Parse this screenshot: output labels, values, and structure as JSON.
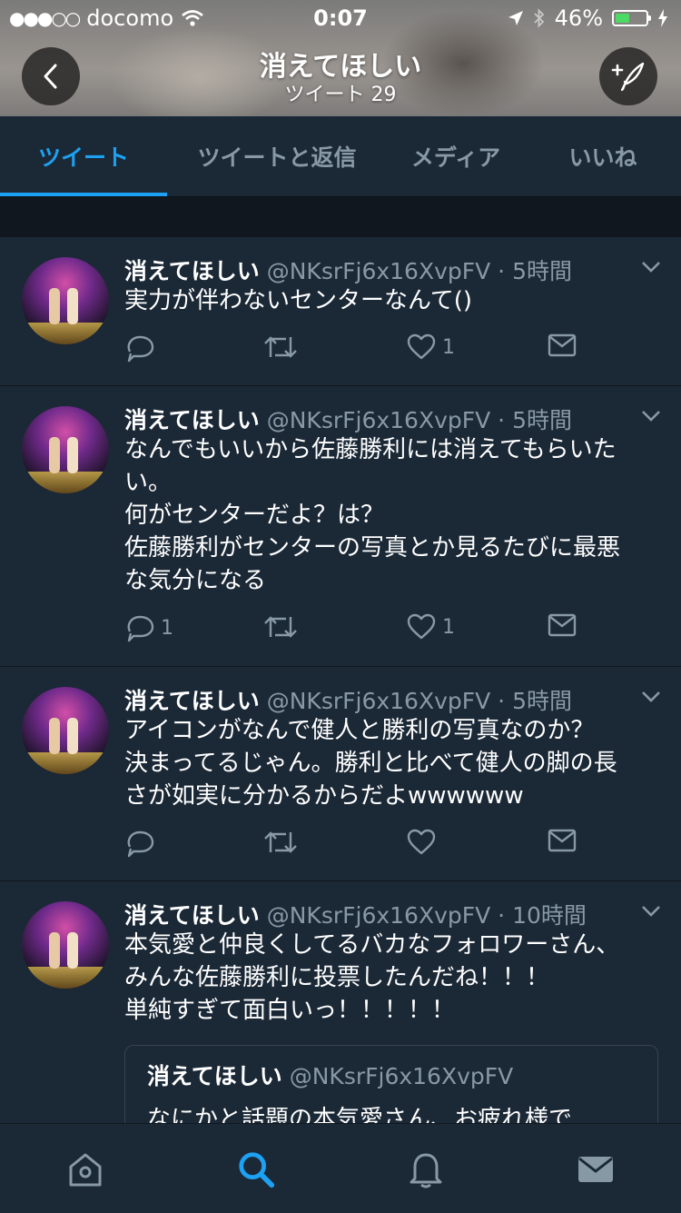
{
  "status_bar": {
    "signal_dots": "●●●○○",
    "carrier": "docomo",
    "time": "0:07",
    "battery_percent": "46%",
    "battery_level": 0.46
  },
  "header": {
    "title": "消えてほしい",
    "tweet_count": "ツイート 29"
  },
  "tabs": [
    {
      "label": "ツイート",
      "active": true
    },
    {
      "label": "ツイートと返信",
      "active": false
    },
    {
      "label": "メディア",
      "active": false
    },
    {
      "label": "いいね",
      "active": false
    }
  ],
  "tweets": [
    {
      "name": "消えてほしい",
      "meta": "@NKsrFj6x16XvpFV · 5時間",
      "lines": [
        "実力が伴わないセンターなんて()"
      ],
      "reply_count": "",
      "like_count": "1"
    },
    {
      "name": "消えてほしい",
      "meta": "@NKsrFj6x16XvpFV · 5時間",
      "lines": [
        "なんでもいいから佐藤勝利には消えてもらいた",
        "い。",
        "何がセンターだよ？は？",
        "佐藤勝利がセンターの写真とか見るたびに最悪",
        "な気分になる"
      ],
      "reply_count": "1",
      "like_count": "1"
    },
    {
      "name": "消えてほしい",
      "meta": "@NKsrFj6x16XvpFV · 5時間",
      "lines": [
        "アイコンがなんで健人と勝利の写真なのか？",
        "決まってるじゃん。勝利と比べて健人の脚の長",
        "さが如実に分かるからだよwwwwww"
      ],
      "reply_count": "",
      "like_count": ""
    },
    {
      "name": "消えてほしい",
      "meta": "@NKsrFj6x16XvpFV · 10時間",
      "lines": [
        "本気愛と仲良くしてるバカなフォロワーさん、",
        "みんな佐藤勝利に投票したんだね！！！",
        "単純すぎて面白いっ！！！！！"
      ],
      "quote": {
        "name": "消えてほしい",
        "handle": "@NKsrFj6x16XvpFV",
        "text": "なにかと話題の本気愛さん、お疲れ様で"
      }
    }
  ],
  "icons": {
    "back": "chevron-left-icon",
    "compose": "compose-tweet-icon",
    "reply": "reply-icon",
    "retweet": "retweet-icon",
    "like": "heart-icon",
    "dm": "envelope-icon",
    "more": "chevron-down-icon",
    "nav_home": "home-icon",
    "nav_search": "search-icon",
    "nav_notifications": "bell-icon",
    "nav_messages": "envelope-icon"
  },
  "colors": {
    "accent": "#1da1f2",
    "background": "#1b2836",
    "secondary_text": "#8899a6"
  }
}
